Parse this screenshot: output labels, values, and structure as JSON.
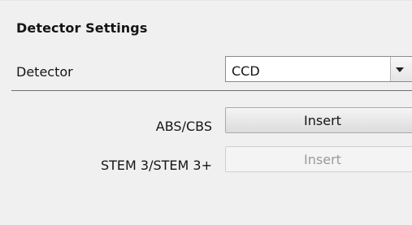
{
  "section": {
    "title": "Detector Settings"
  },
  "detector": {
    "label": "Detector",
    "selected": "CCD",
    "arrow_icon": "dropdown-arrow-icon"
  },
  "rows": [
    {
      "label": "ABS/CBS",
      "button_label": "Insert",
      "enabled": true
    },
    {
      "label": "STEM 3/STEM 3+",
      "button_label": "Insert",
      "enabled": false
    }
  ],
  "colors": {
    "background": "#f0f0f0",
    "separator": "#6f6f6f",
    "disabled_text": "#9a9a9a"
  }
}
